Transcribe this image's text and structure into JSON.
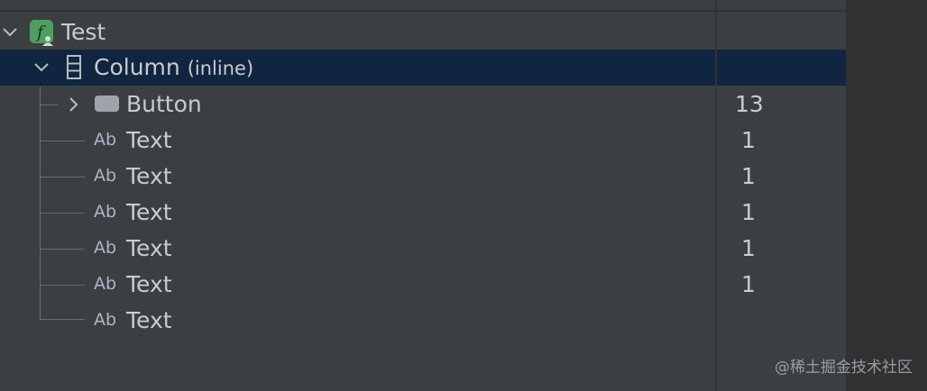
{
  "tree": {
    "root": {
      "label": "Test"
    },
    "column": {
      "label": "Column",
      "suffix": "(inline)"
    },
    "children": [
      {
        "type": "Button",
        "label": "Button",
        "count": "13"
      },
      {
        "type": "Text",
        "label": "Text",
        "count": "1"
      },
      {
        "type": "Text",
        "label": "Text",
        "count": "1"
      },
      {
        "type": "Text",
        "label": "Text",
        "count": "1"
      },
      {
        "type": "Text",
        "label": "Text",
        "count": "1"
      },
      {
        "type": "Text",
        "label": "Text",
        "count": "1"
      },
      {
        "type": "Text",
        "label": "Text",
        "count": ""
      }
    ],
    "text_icon_glyph": "Ab"
  },
  "watermark": "@稀土掘金技术社区",
  "colors": {
    "background": "#3c3f41",
    "selection": "#0f2540",
    "root_icon": "#4e9e5f",
    "text": "#c9cbcd"
  }
}
